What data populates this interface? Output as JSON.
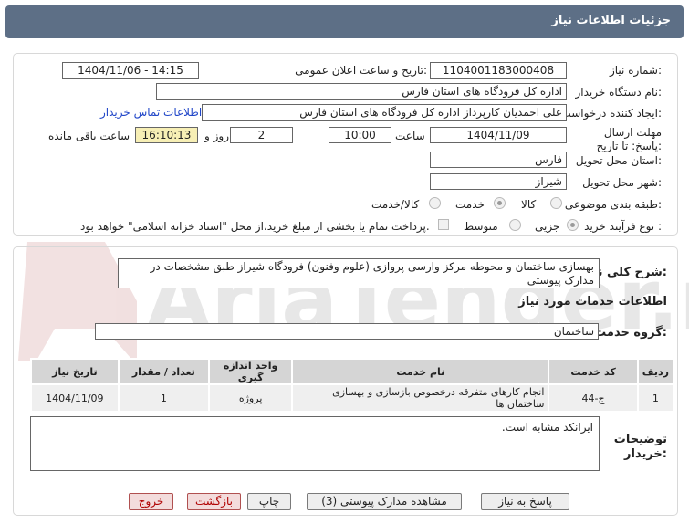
{
  "header": {
    "title": "جزئیات اطلاعات نیاز"
  },
  "fields": {
    "need_number_label": "شماره نیاز:",
    "need_number": "1104001183000408",
    "announce_label": "تاریخ و ساعت اعلان عمومی:",
    "announce_value": "1404/11/06 - 14:15",
    "buyer_label": "نام دستگاه خریدار:",
    "buyer_value": "اداره کل فرودگاه های استان فارس",
    "creator_label": "ایجاد کننده درخواست:",
    "creator_value": "علی  احمدیان کارپرداز اداره کل فرودگاه های استان فارس",
    "contact_link": "اطلاعات تماس خریدار",
    "deadline_label": "مهلت ارسال پاسخ: تا تاریخ:",
    "deadline_date": "1404/11/09",
    "time_label": "ساعت",
    "deadline_time": "10:00",
    "days_value": "2",
    "days_label": "روز و",
    "remaining_time": "16:10:13",
    "remaining_label": "ساعت باقی مانده",
    "province_label": "استان محل تحویل:",
    "province_value": "فارس",
    "city_label": "شهر محل تحویل:",
    "city_value": "شیراز",
    "category_label": "طبقه بندی موضوعی:",
    "category_options": [
      "کالا",
      "خدمت",
      "کالا/خدمت"
    ],
    "process_label": "نوع فرآیند خرید :",
    "process_options": [
      "جزیی",
      "متوسط"
    ],
    "payment_note": "پرداخت تمام یا بخشی از مبلغ خرید،از محل \"اسناد خزانه اسلامی\" خواهد بود."
  },
  "description": {
    "label": "شرح کلی نیاز:",
    "value": "بهسازی ساختمان و محوطه مرکز وارسی پروازی (علوم وفنون) فرودگاه شیراز طبق مشخصات در مدارک پیوستی"
  },
  "services": {
    "section_title": "اطلاعات خدمات مورد نیاز",
    "group_label": "گروه خدمت:",
    "group_value": "ساختمان",
    "columns": [
      "ردیف",
      "کد خدمت",
      "نام خدمت",
      "واحد اندازه گیری",
      "تعداد / مقدار",
      "تاریخ نیاز"
    ],
    "rows": [
      {
        "index": "1",
        "code": "ج-44",
        "name": "انجام کارهای متفرقه درخصوص بازسازی و بهسازی ساختمان ها",
        "unit": "پروژه",
        "qty": "1",
        "date": "1404/11/09"
      }
    ]
  },
  "buyer_notes": {
    "label": "توضیحات خریدار:",
    "value": "ایرانکد مشابه است."
  },
  "buttons": {
    "reply": "پاسخ به نیاز",
    "attachments": "مشاهده مدارک پیوستی (3)",
    "print": "چاپ",
    "back": "بازگشت",
    "exit": "خروج"
  },
  "watermark": {
    "text": "AriaTender.net"
  },
  "colors": {
    "header_bg": "#5d6f86",
    "yellow_box": "#f7efb5",
    "link": "#2046c8",
    "watermark": "#c9c9c9"
  }
}
